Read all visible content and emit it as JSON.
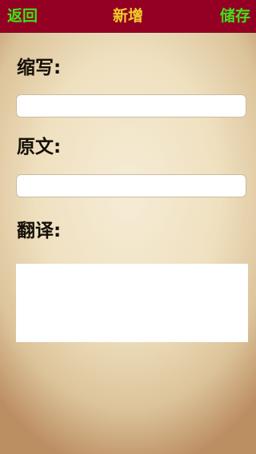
{
  "navbar": {
    "back_label": "返回",
    "title": "新增",
    "save_label": "储存",
    "colors": {
      "background": "#930024",
      "back": "#3fe21a",
      "title": "#f2cd2b",
      "save": "#3fe21a"
    }
  },
  "form": {
    "abbreviation": {
      "label": "缩写:",
      "value": "",
      "placeholder": ""
    },
    "original": {
      "label": "原文:",
      "value": "",
      "placeholder": ""
    },
    "translation": {
      "label": "翻译:",
      "value": "",
      "placeholder": ""
    }
  }
}
